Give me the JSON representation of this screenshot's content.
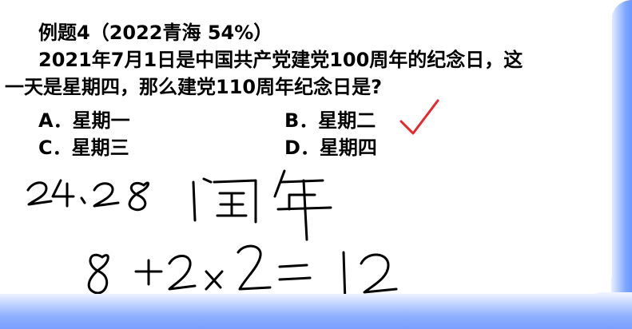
{
  "problem": {
    "title": "例题4（2022青海 54%）",
    "question_line1": "2021年7月1日是中国共产党建党100周年的纪念日，这",
    "question_line2": "一天是星期四，那么建党110周年纪念日是?"
  },
  "options": {
    "a": "A．星期一",
    "b": "B．星期二",
    "c": "C．星期三",
    "d": "D．星期四"
  },
  "handwriting": {
    "line1": "24、28 闰年",
    "line2": "8+2×2=12"
  },
  "colors": {
    "check_mark": "#e8262b",
    "frame": "#7aa0ff"
  }
}
